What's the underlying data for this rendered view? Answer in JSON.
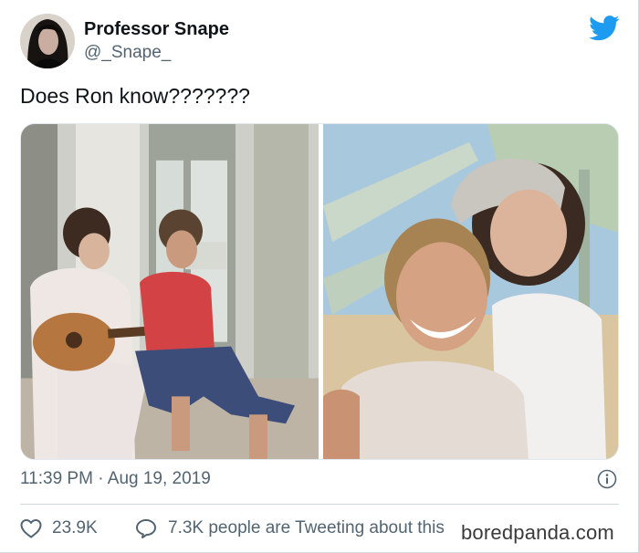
{
  "author": {
    "name": "Professor Snape",
    "handle": "@_Snape_"
  },
  "tweet": {
    "text": "Does Ron know???????"
  },
  "meta": {
    "time": "11:39 PM",
    "separator": " · ",
    "date": "Aug 19, 2019"
  },
  "stats": {
    "likes": "23.9K",
    "conversation": "7.3K people are Tweeting about this"
  },
  "watermark": "boredpanda.com",
  "colors": {
    "twitter_blue": "#1d9bf0",
    "secondary_text": "#536471",
    "divider": "#cfd9de"
  },
  "icons": [
    "twitter-bird-icon",
    "info-icon",
    "heart-icon",
    "speech-bubble-icon"
  ]
}
